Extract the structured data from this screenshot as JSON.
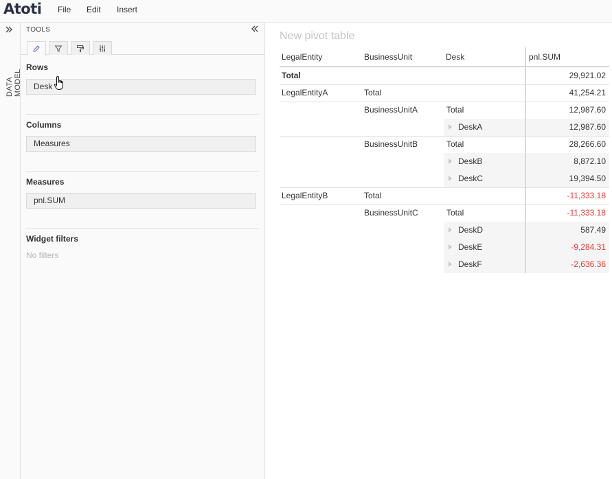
{
  "app": {
    "logo": "Atoti",
    "menu": [
      "File",
      "Edit",
      "Insert"
    ]
  },
  "rail": {
    "label": "DATA MODEL",
    "expand_icon": "double-chevron-right-icon"
  },
  "tools": {
    "title": "TOOLS",
    "collapse_icon": "double-chevron-left-icon",
    "tabs": [
      {
        "icon": "pencil-icon",
        "active": true
      },
      {
        "icon": "filter-icon",
        "active": false
      },
      {
        "icon": "paint-roller-icon",
        "active": false
      },
      {
        "icon": "sliders-icon",
        "active": false
      }
    ],
    "rows_title": "Rows",
    "rows_value": "Desk",
    "columns_title": "Columns",
    "columns_value": "Measures",
    "measures_title": "Measures",
    "measures_value": "pnl.SUM",
    "filters_title": "Widget filters",
    "filters_empty": "No filters"
  },
  "pivot": {
    "title": "New pivot table",
    "headers": [
      "LegalEntity",
      "BusinessUnit",
      "Desk",
      "pnl.SUM"
    ],
    "rows": [
      {
        "legal": "Total",
        "unit": "",
        "desk": "",
        "value": "29,921.02",
        "negative": false,
        "bold_legal": true
      },
      {
        "legal": "LegalEntityA",
        "unit": "Total",
        "desk": "",
        "value": "41,254.21",
        "negative": false
      },
      {
        "legal": "",
        "unit": "BusinessUnitA",
        "desk": "Total",
        "value": "12,987.60",
        "negative": false
      },
      {
        "legal": "",
        "unit": "",
        "desk": "DeskA",
        "value": "12,987.60",
        "negative": false,
        "leaf": true
      },
      {
        "legal": "",
        "unit": "BusinessUnitB",
        "desk": "Total",
        "value": "28,266.60",
        "negative": false
      },
      {
        "legal": "",
        "unit": "",
        "desk": "DeskB",
        "value": "8,872.10",
        "negative": false,
        "leaf": true
      },
      {
        "legal": "",
        "unit": "",
        "desk": "DeskC",
        "value": "19,394.50",
        "negative": false,
        "leaf": true
      },
      {
        "legal": "LegalEntityB",
        "unit": "Total",
        "desk": "",
        "value": "-11,333.18",
        "negative": true
      },
      {
        "legal": "",
        "unit": "BusinessUnitC",
        "desk": "Total",
        "value": "-11,333.18",
        "negative": true
      },
      {
        "legal": "",
        "unit": "",
        "desk": "DeskD",
        "value": "587.49",
        "negative": false,
        "leaf": true
      },
      {
        "legal": "",
        "unit": "",
        "desk": "DeskE",
        "value": "-9,284.31",
        "negative": true,
        "leaf": true
      },
      {
        "legal": "",
        "unit": "",
        "desk": "DeskF",
        "value": "-2,636.36",
        "negative": true,
        "leaf": true
      }
    ],
    "colors": {
      "negative": "#e53935",
      "leaf_shade": "#f5f5f5"
    }
  }
}
